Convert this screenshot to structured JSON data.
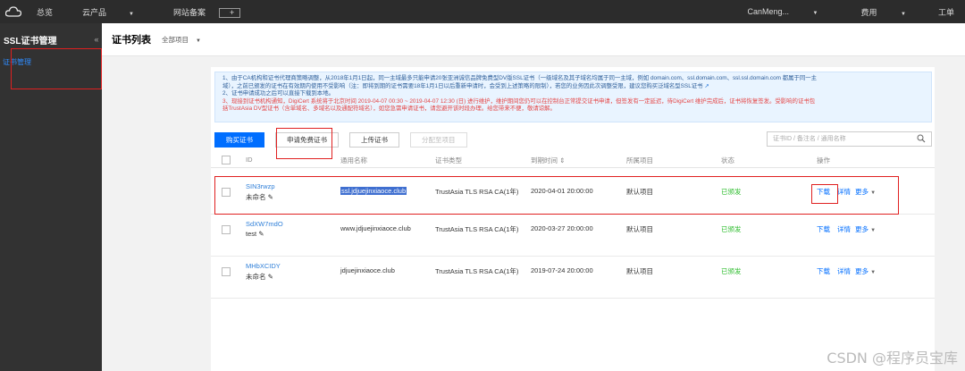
{
  "topbar": {
    "nav": [
      "总览",
      "云产品",
      "网站备案"
    ],
    "plus": "+",
    "right": [
      "CanMeng...",
      "费用",
      "工单"
    ]
  },
  "sidebar": {
    "title": "SSL证书管理",
    "collapse": "«",
    "item": "证书管理"
  },
  "header": {
    "title": "证书列表",
    "project": "全部项目"
  },
  "notice": {
    "line1": "1、由于CA机构和证书代理商策略调整，从2018年1月1日起，同一主域最多只能申请20张亚洲诚信品牌免费型DV版SSL证书（一级域名及其子域名均属于同一主域，例如 domain.com、ssl.domain.com、ssl.ssl.domain.com 都属于同一主",
    "line2": "域），之前已颁发的证书在有效期内使用不受影响（注：即将到期的证书需要18年1月1日以后重新申请时，会受到上述策略的限制），若您的业务因此次调整受限，建议您购买泛域名型SSL证书",
    "line3": "2、证书申请成功之后可以直接下载到本地。",
    "line4": "3、现接到证书机构通知，DigiCert 系统将于北京时间 2019-04-07 00:30 ~ 2019-04-07 12:30 (日) 进行维护，维护期间您仍可以在控制台正常提交证书申请，但签发有一定延迟，待DigiCert 维护完成后，证书将恢复签发。受影响的证书包",
    "line5": "括TrustAsia DV型证书（含单域名、多域名以及通配符域名），如您急需申请证书，请您避开该时段办理。给您带来不便，敬请谅解。"
  },
  "toolbar": {
    "buy": "购买证书",
    "apply_free": "申请免费证书",
    "upload": "上传证书",
    "assign": "分配至项目",
    "search_placeholder": "证书ID / 备注名 / 通用名称"
  },
  "table": {
    "columns": [
      "ID",
      "通用名称",
      "证书类型",
      "到期时间",
      "所属项目",
      "状态",
      "操作"
    ],
    "rows": [
      {
        "id": "SIN3rwzp",
        "note": "未命名",
        "domain": "ssl.jdjuejinxiaoce.club",
        "type": "TrustAsia TLS RSA CA(1年)",
        "expire": "2020-04-01 20:00:00",
        "project": "默认项目",
        "status": "已颁发",
        "download": "下载",
        "detail": "详情",
        "more": "更多"
      },
      {
        "id": "SdXW7mdO",
        "note": "test",
        "domain": "www.jdjuejinxiaoce.club",
        "type": "TrustAsia TLS RSA CA(1年)",
        "expire": "2020-03-27 20:00:00",
        "project": "默认项目",
        "status": "已颁发",
        "download": "下载",
        "detail": "详情",
        "more": "更多"
      },
      {
        "id": "MHbXCIDY",
        "note": "未命名",
        "domain": "jdjuejinxiaoce.club",
        "type": "TrustAsia TLS RSA CA(1年)",
        "expire": "2019-07-24 20:00:00",
        "project": "默认项目",
        "status": "已颁发",
        "download": "下载",
        "detail": "详情",
        "more": "更多"
      }
    ]
  },
  "watermark": "CSDN @程序员宝库",
  "colors": {
    "primary": "#006eff",
    "issued": "#2ebd2e",
    "highlight": "#e02020"
  }
}
